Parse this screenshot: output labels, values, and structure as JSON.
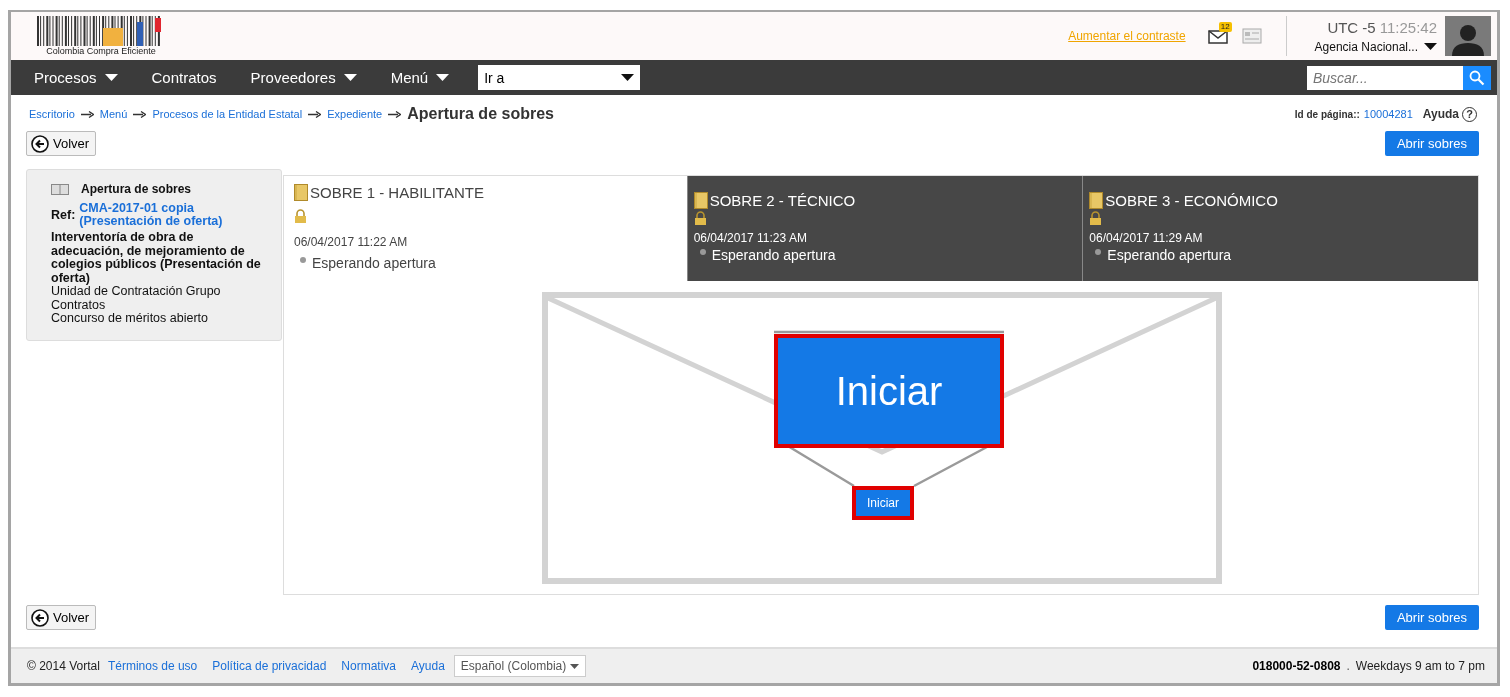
{
  "header": {
    "logo_text": "Colombia Compra Eficiente",
    "contrast_link": "Aumentar el contraste",
    "mail_count": "12",
    "timezone": "UTC -5",
    "time": "11:25:42",
    "agency": "Agencia Nacional..."
  },
  "nav": {
    "items": [
      {
        "label": "Procesos",
        "dropdown": true
      },
      {
        "label": "Contratos",
        "dropdown": false
      },
      {
        "label": "Proveedores",
        "dropdown": true
      },
      {
        "label": "Menú",
        "dropdown": true
      }
    ],
    "goto": "Ir a",
    "search_placeholder": "Buscar..."
  },
  "breadcrumb": {
    "links": [
      "Escritorio",
      "Menú",
      "Procesos de la Entidad Estatal",
      "Expediente"
    ],
    "current": "Apertura de sobres"
  },
  "page_id": {
    "label": "Id de página::",
    "value": "10004281",
    "help": "Ayuda",
    "help_icon": "?"
  },
  "buttons": {
    "top": {
      "back": "Volver",
      "open": "Abrir sobres"
    },
    "bottom": {
      "back": "Volver",
      "open": "Abrir sobres"
    }
  },
  "summary": {
    "title": "Apertura de sobres",
    "ref_label": "Ref:",
    "ref": "CMA-2017-01 copia (Presentación de oferta)",
    "description": "Interventoría de obra de adecuación, de mejoramiento de colegios públicos (Presentación de oferta)",
    "lines": [
      "Unidad de Contratación Grupo Contratos",
      "Concurso de méritos abierto"
    ]
  },
  "envelopes": [
    {
      "title": "SOBRE 1 - HABILITANTE",
      "date": "06/04/2017 11:22 AM",
      "status": "Esperando apertura",
      "selected": true
    },
    {
      "title": "SOBRE 2 - TÉCNICO",
      "date": "06/04/2017 11:23 AM",
      "status": "Esperando apertura",
      "selected": false
    },
    {
      "title": "SOBRE 3 - ECONÓMICO",
      "date": "06/04/2017 11:29 AM",
      "status": "Esperando apertura",
      "selected": false
    }
  ],
  "start": {
    "button": "Iniciar",
    "callout": "Iniciar"
  },
  "footer": {
    "copyright": "© 2014 Vortal",
    "links": [
      "Términos de uso",
      "Política de privacidad",
      "Normativa",
      "Ayuda"
    ],
    "language": "Español (Colombia)",
    "phone": "018000-52-0808",
    "separator": ".",
    "hours": "Weekdays 9 am to 7 pm"
  }
}
